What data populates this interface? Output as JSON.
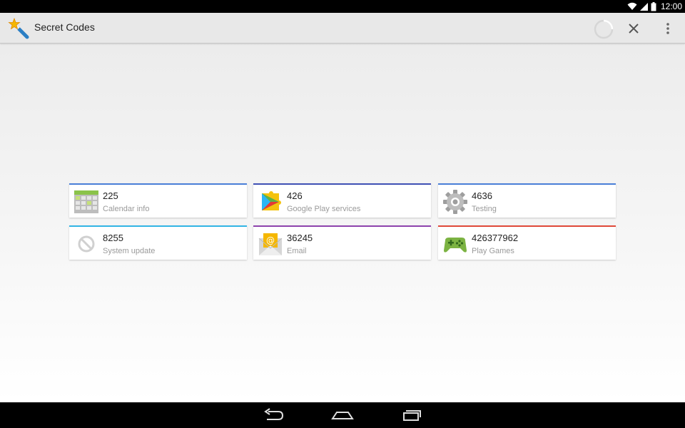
{
  "status_bar": {
    "time": "12:00"
  },
  "action_bar": {
    "title": "Secret Codes",
    "accent": "#4a7fd8"
  },
  "codes": [
    {
      "code": "225",
      "label": "Calendar info",
      "icon": "calendar-icon",
      "color": "#4a7fd8"
    },
    {
      "code": "426",
      "label": "Google Play services",
      "icon": "play-services-icon",
      "color": "#3f51b5"
    },
    {
      "code": "4636",
      "label": "Testing",
      "icon": "gear-icon",
      "color": "#4a7fd8"
    },
    {
      "code": "8255",
      "label": "System update",
      "icon": "blocked-icon",
      "color": "#33b5e5"
    },
    {
      "code": "36245",
      "label": "Email",
      "icon": "email-icon",
      "color": "#8e44ad"
    },
    {
      "code": "426377962",
      "label": "Play Games",
      "icon": "gamepad-icon",
      "color": "#e04a3a"
    }
  ],
  "nav_bar": {
    "buttons": [
      "back-icon",
      "home-icon",
      "recents-icon"
    ]
  }
}
